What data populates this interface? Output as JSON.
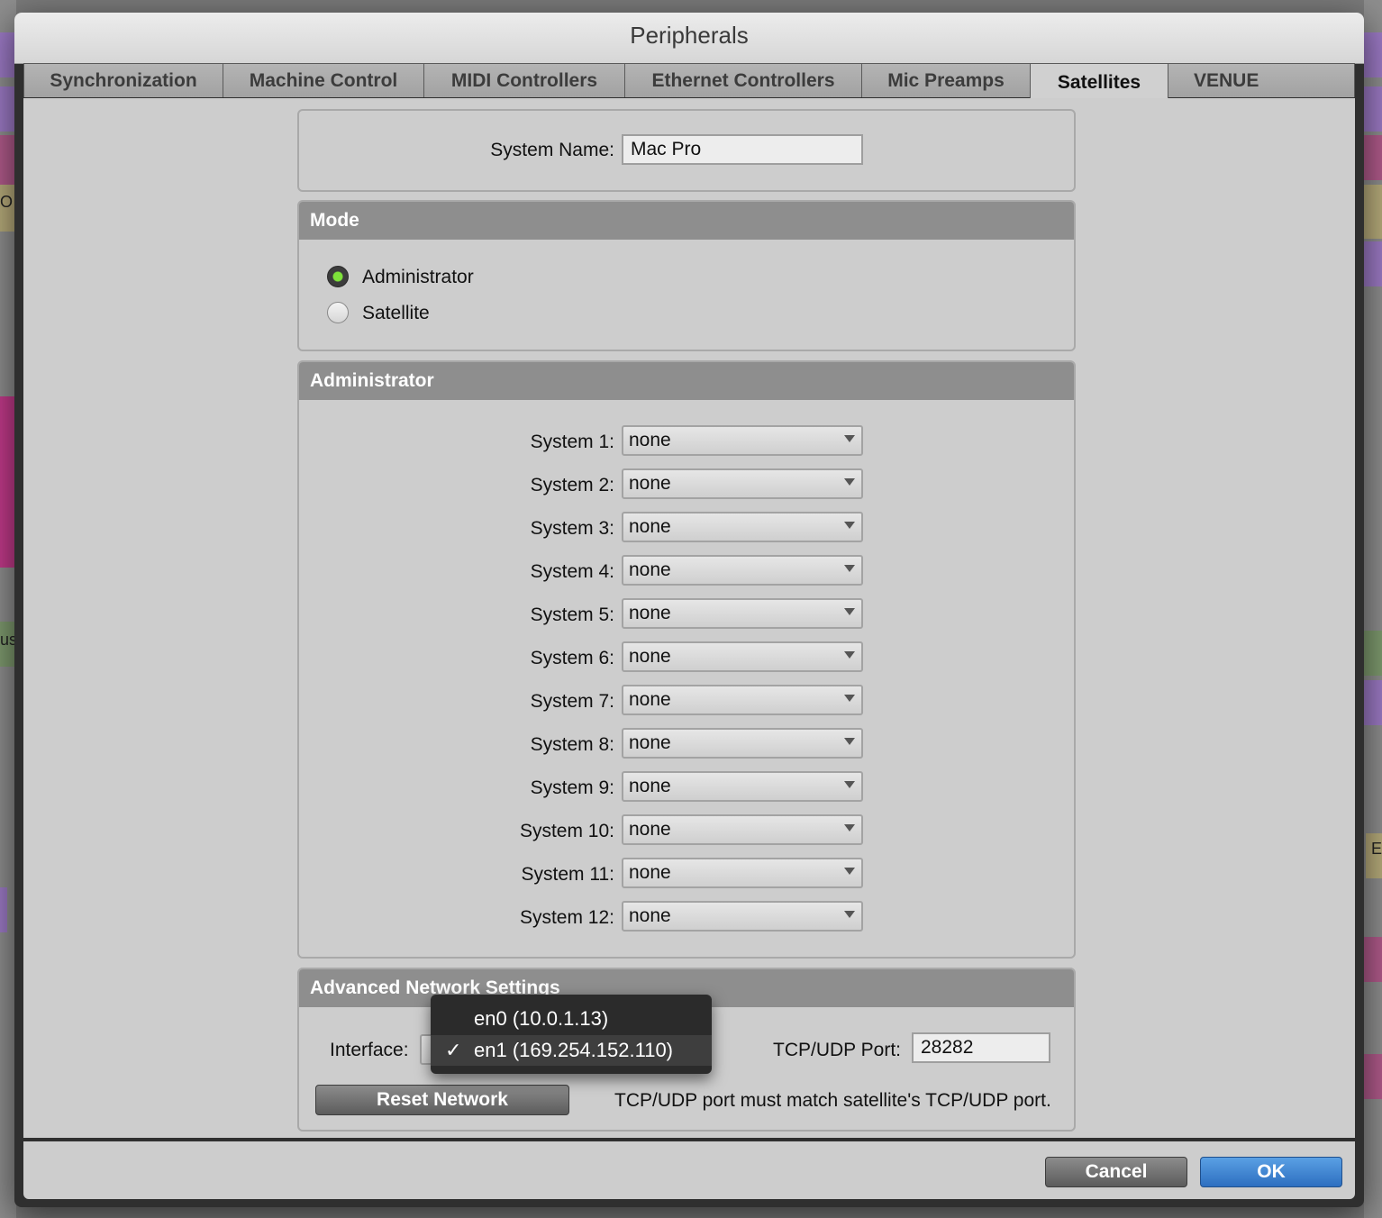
{
  "window": {
    "title": "Peripherals"
  },
  "tabs": [
    {
      "label": "Synchronization"
    },
    {
      "label": "Machine Control"
    },
    {
      "label": "MIDI Controllers"
    },
    {
      "label": "Ethernet Controllers"
    },
    {
      "label": "Mic Preamps"
    },
    {
      "label": "Satellites",
      "active": true
    },
    {
      "label": "VENUE"
    }
  ],
  "system_name": {
    "label": "System Name:",
    "value": "Mac Pro"
  },
  "mode": {
    "header": "Mode",
    "options": [
      {
        "label": "Administrator",
        "selected": true
      },
      {
        "label": "Satellite",
        "selected": false
      }
    ]
  },
  "administrator": {
    "header": "Administrator",
    "systems": [
      {
        "label": "System 1:",
        "value": "none"
      },
      {
        "label": "System 2:",
        "value": "none"
      },
      {
        "label": "System 3:",
        "value": "none"
      },
      {
        "label": "System 4:",
        "value": "none"
      },
      {
        "label": "System 5:",
        "value": "none"
      },
      {
        "label": "System 6:",
        "value": "none"
      },
      {
        "label": "System 7:",
        "value": "none"
      },
      {
        "label": "System 8:",
        "value": "none"
      },
      {
        "label": "System 9:",
        "value": "none"
      },
      {
        "label": "System 10:",
        "value": "none"
      },
      {
        "label": "System 11:",
        "value": "none"
      },
      {
        "label": "System 12:",
        "value": "none"
      }
    ]
  },
  "network": {
    "header": "Advanced Network Settings",
    "interface_label": "Interface:",
    "interface_options": [
      {
        "label": "en0 (10.0.1.13)",
        "checked": false
      },
      {
        "label": "en1 (169.254.152.110)",
        "checked": true
      }
    ],
    "check_mark": "✓",
    "port_label": "TCP/UDP Port:",
    "port_value": "28282",
    "reset_label": "Reset Network",
    "note": "TCP/UDP port must match satellite's TCP/UDP port."
  },
  "buttons": {
    "cancel": "Cancel",
    "ok": "OK"
  },
  "background": {
    "left_fragment_1": "O",
    "left_fragment_2": "us",
    "right_fragment": "E"
  },
  "colors": {
    "accent_blue": "#2d6fc0",
    "radio_green": "#7ee23a",
    "header_gray": "#8e8e8e"
  }
}
